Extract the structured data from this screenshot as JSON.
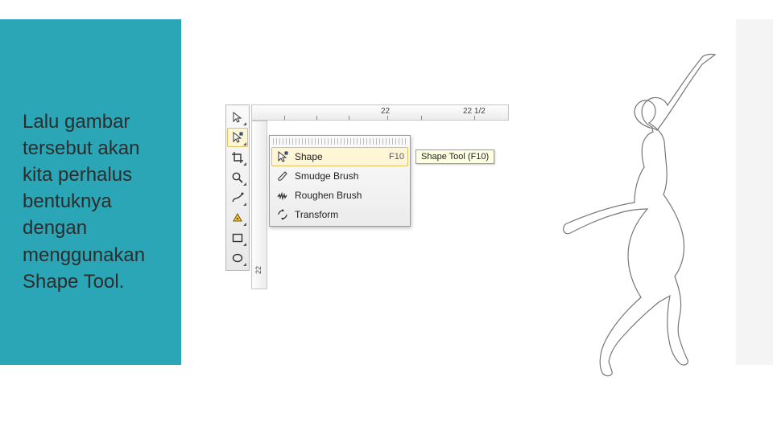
{
  "panel": {
    "text": "Lalu gambar tersebut akan kita perhalus bentuknya dengan menggunakan Shape Tool."
  },
  "ruler": {
    "label1": "22",
    "label2": "22 1/2",
    "vlabel": "22"
  },
  "toolbox": {
    "tools": [
      {
        "name": "pick-tool"
      },
      {
        "name": "shape-tool"
      },
      {
        "name": "crop-tool"
      },
      {
        "name": "zoom-tool"
      },
      {
        "name": "freehand-tool"
      },
      {
        "name": "smart-fill-tool"
      },
      {
        "name": "rectangle-tool"
      },
      {
        "name": "ellipse-tool"
      }
    ]
  },
  "flyout": {
    "items": [
      {
        "label": "Shape",
        "shortcut": "F10"
      },
      {
        "label": "Smudge Brush",
        "shortcut": ""
      },
      {
        "label": "Roughen Brush",
        "shortcut": ""
      },
      {
        "label": "Transform",
        "shortcut": ""
      }
    ]
  },
  "tooltip": {
    "text": "Shape Tool (F10)"
  }
}
